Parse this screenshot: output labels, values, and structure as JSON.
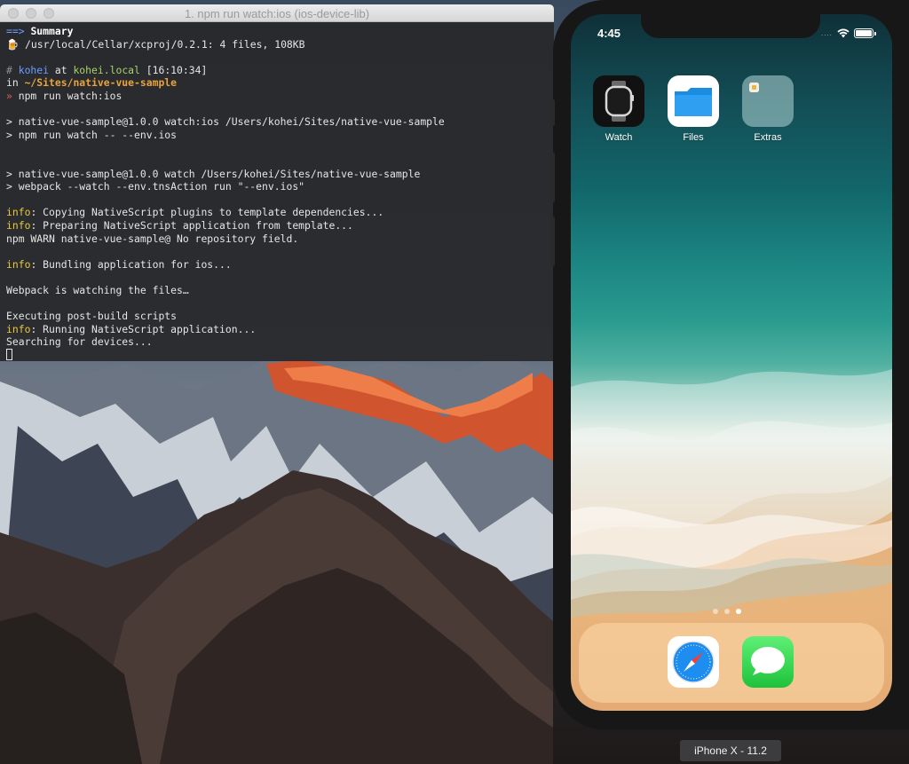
{
  "terminal": {
    "window_title": "1. npm run watch:ios (ios-device-lib)",
    "lines": [
      [
        {
          "t": "==> ",
          "c": "c-blue"
        },
        {
          "t": "Summary",
          "c": "c-bold"
        }
      ],
      [
        {
          "t": "🍺 /usr/local/Cellar/xcproj/0.2.1: 4 files, 108KB",
          "c": ""
        }
      ],
      [
        {
          "t": "",
          "c": ""
        }
      ],
      [
        {
          "t": "# ",
          "c": "c-gray"
        },
        {
          "t": "kohei",
          "c": "c-blue"
        },
        {
          "t": " at ",
          "c": ""
        },
        {
          "t": "kohei.local",
          "c": "c-green"
        },
        {
          "t": " [16:10:34]",
          "c": ""
        }
      ],
      [
        {
          "t": "in ",
          "c": ""
        },
        {
          "t": "~/Sites/native-vue-sample",
          "c": "c-orange"
        }
      ],
      [
        {
          "t": "» ",
          "c": "c-red"
        },
        {
          "t": "npm run watch:ios",
          "c": ""
        }
      ],
      [
        {
          "t": "",
          "c": ""
        }
      ],
      [
        {
          "t": "> native-vue-sample@1.0.0 watch:ios /Users/kohei/Sites/native-vue-sample",
          "c": ""
        }
      ],
      [
        {
          "t": "> npm run watch -- --env.ios",
          "c": ""
        }
      ],
      [
        {
          "t": "",
          "c": ""
        }
      ],
      [
        {
          "t": "",
          "c": ""
        }
      ],
      [
        {
          "t": "> native-vue-sample@1.0.0 watch /Users/kohei/Sites/native-vue-sample",
          "c": ""
        }
      ],
      [
        {
          "t": "> webpack --watch --env.tnsAction run \"--env.ios\"",
          "c": ""
        }
      ],
      [
        {
          "t": "",
          "c": ""
        }
      ],
      [
        {
          "t": "info",
          "c": "c-yellow"
        },
        {
          "t": ": Copying NativeScript plugins to template dependencies...",
          "c": ""
        }
      ],
      [
        {
          "t": "info",
          "c": "c-yellow"
        },
        {
          "t": ": Preparing NativeScript application from template...",
          "c": ""
        }
      ],
      [
        {
          "t": "npm WARN native-vue-sample@ No repository field.",
          "c": ""
        }
      ],
      [
        {
          "t": "",
          "c": ""
        }
      ],
      [
        {
          "t": "info",
          "c": "c-yellow"
        },
        {
          "t": ": Bundling application for ios...",
          "c": ""
        }
      ],
      [
        {
          "t": "",
          "c": ""
        }
      ],
      [
        {
          "t": "Webpack is watching the files…",
          "c": ""
        }
      ],
      [
        {
          "t": "",
          "c": ""
        }
      ],
      [
        {
          "t": "Executing post-build scripts",
          "c": ""
        }
      ],
      [
        {
          "t": "info",
          "c": "c-yellow"
        },
        {
          "t": ": Running NativeScript application...",
          "c": ""
        }
      ],
      [
        {
          "t": "Searching for devices...",
          "c": ""
        }
      ]
    ]
  },
  "phone": {
    "status_time": "4:45",
    "signal_dots": "....",
    "apps": [
      {
        "label": "Watch",
        "icon": "watch-app-icon"
      },
      {
        "label": "Files",
        "icon": "files-app-icon"
      },
      {
        "label": "Extras",
        "icon": "extras-folder-icon"
      }
    ],
    "page_count": 3,
    "current_page": 3,
    "dock_apps": [
      {
        "icon": "safari-app-icon"
      },
      {
        "icon": "messages-app-icon"
      }
    ]
  },
  "simulator": {
    "device_label": "iPhone X - 11.2"
  },
  "colors": {
    "terminal_bg": "#28282a",
    "prompt_path": "#e9a33a",
    "info": "#e8c93c",
    "host": "#a7d26a",
    "user": "#6d9cff"
  }
}
